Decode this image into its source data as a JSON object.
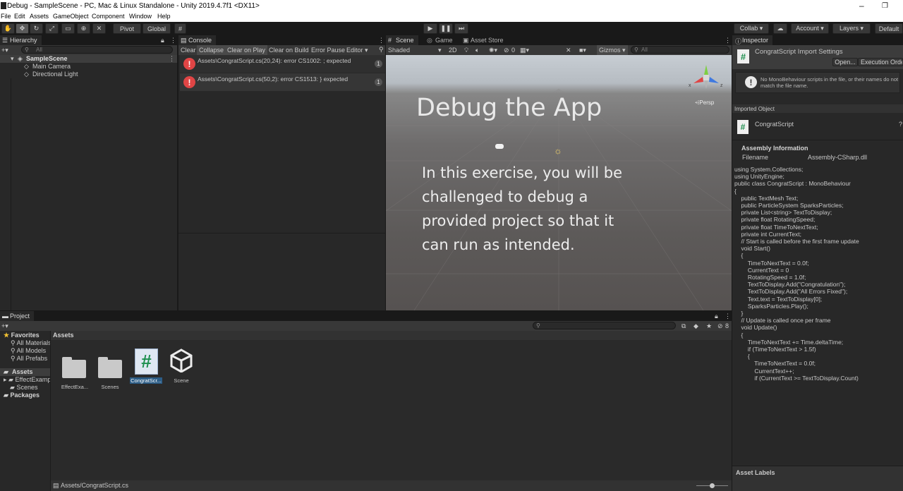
{
  "window": {
    "title": "Debug - SampleScene - PC, Mac & Linux Standalone - Unity 2019.4.7f1 <DX11>",
    "minimize": "–",
    "restore": "❐"
  },
  "menu": [
    "File",
    "Edit",
    "Assets",
    "GameObject",
    "Component",
    "Window",
    "Help"
  ],
  "toolbar": {
    "pivot": "Pivot",
    "global": "Global",
    "collab": "Collab ▾",
    "account": "Account ▾",
    "layers": "Layers ▾",
    "layout": "Default"
  },
  "hierarchy": {
    "tab": "Hierarchy",
    "add": "+▾",
    "search_placeholder": "All",
    "scene": "SampleScene",
    "items": [
      "Main Camera",
      "Directional Light"
    ]
  },
  "console": {
    "tab": "Console",
    "buttons": [
      "Clear",
      "Collapse",
      "Clear on Play",
      "Clear on Build",
      "Error Pause",
      "Editor ▾"
    ],
    "errors": [
      {
        "text": "Assets\\CongratScript.cs(20,24): error CS1002: ; expected",
        "count": "1"
      },
      {
        "text": "Assets\\CongratScript.cs(50,2): error CS1513: } expected",
        "count": "1"
      }
    ]
  },
  "scene": {
    "tabs": [
      "Scene",
      "Game",
      "Asset Store"
    ],
    "shading": "Shaded",
    "mode_2d": "2D",
    "hidden_count": "0",
    "gizmos": "Gizmos ▾",
    "search_placeholder": "All",
    "persp": "Persp",
    "gizmo_x": "x",
    "gizmo_z": "z",
    "overlay_title": "Debug the App",
    "overlay_text": "In this exercise, you will be challenged to debug a provided project so that it can run as intended."
  },
  "project": {
    "tab": "Project",
    "add": "+▾",
    "hidden_count": "8",
    "favorites": "Favorites",
    "favorite_items": [
      "All Materials",
      "All Models",
      "All Prefabs"
    ],
    "assets_root": "Assets",
    "asset_folders": [
      "EffectExamples",
      "Scenes"
    ],
    "packages": "Packages",
    "breadcrumb": "Assets",
    "assets": [
      {
        "label": "EffectExa...",
        "kind": "folder"
      },
      {
        "label": "Scenes",
        "kind": "folder"
      },
      {
        "label": "CongratScr...",
        "kind": "script"
      },
      {
        "label": "Scene",
        "kind": "unity"
      }
    ],
    "footer_path": "Assets/CongratScript.cs"
  },
  "inspector": {
    "tab": "Inspector",
    "import_title": "CongratScript Import Settings",
    "open_button": "Open...",
    "exec_order_button": "Execution Order...",
    "warning": "No MonoBehaviour scripts in the file, or their names do not match the file name.",
    "imported_object": "Imported Object",
    "object_name": "CongratScript",
    "assembly_header": "Assembly Information",
    "filename_label": "Filename",
    "filename_value": "Assembly-CSharp.dll",
    "asset_labels": "Asset Labels",
    "code": [
      "using System.Collections;",
      "using UnityEngine;",
      "",
      "public class CongratScript : MonoBehaviour",
      "{",
      "    public TextMesh Text;",
      "    public ParticleSystem SparksParticles;",
      "",
      "    private List<string> TextToDisplay;",
      "",
      "    private float RotatingSpeed;",
      "    private float TimeToNextText;",
      "",
      "    private int CurrentText;",
      "",
      "    // Start is called before the first frame update",
      "    void Start()",
      "    {",
      "        TimeToNextText = 0.0f;",
      "        CurrentText = 0",
      "",
      "        RotatingSpeed = 1.0f;",
      "",
      "        TextToDisplay.Add(\"Congratulation\");",
      "        TextToDisplay.Add(\"All Errors Fixed\");",
      "",
      "        Text.text = TextToDisplay[0];",
      "",
      "        SparksParticles.Play();",
      "    }",
      "",
      "    // Update is called once per frame",
      "    void Update()",
      "    {",
      "        TimeToNextText += Time.deltaTime;",
      "",
      "        if (TimeToNextText > 1.5f)",
      "        {",
      "            TimeToNextText = 0.0f;",
      "",
      "            CurrentText++;",
      "            if (CurrentText >= TextToDisplay.Count)"
    ]
  },
  "colors": {
    "error": "#e04545",
    "selection": "#2c5d87",
    "script_icon_green": "#1e8f4e"
  }
}
